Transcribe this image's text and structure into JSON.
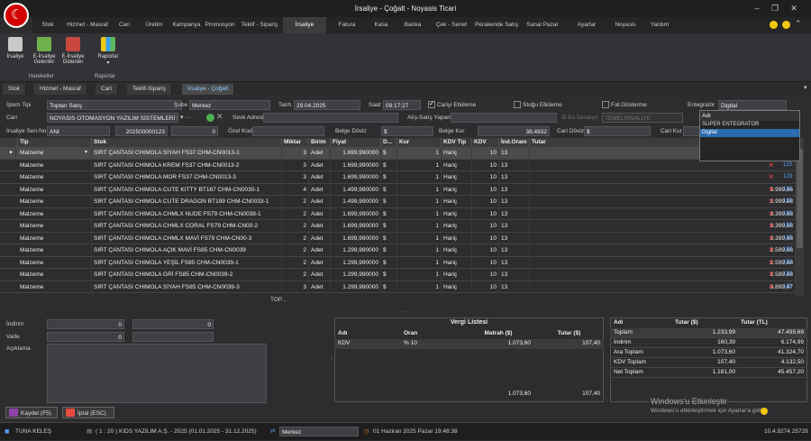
{
  "window": {
    "title": "İrsaliye - Çoğalt - Noyasis Ticari"
  },
  "menu": {
    "tabs": [
      "Stok",
      "Hizmet - Masraf",
      "Cari",
      "Üretim",
      "Kampanya",
      "Promosyon",
      "Teklif - Sipariş",
      "İrsaliye",
      "Fatura",
      "Kasa",
      "Banka",
      "Çek - Senet",
      "Perakende Satış",
      "Sanal Pazar",
      "Ayarlar",
      "Noyasis",
      "Yardım"
    ],
    "active": "İrsaliye"
  },
  "ribbon": {
    "buttons": [
      "İrsaliye",
      "E-İrsaliye Gelenler",
      "E-İrsaliye Gidenler",
      "Raporlar"
    ],
    "groups": [
      "Hareketler",
      "Raporlar"
    ]
  },
  "doctabs": {
    "tabs": [
      "Stok",
      "Hizmet - Masraf",
      "Cari",
      "Teklif-Sipariş",
      "İrsaliye - Çoğalt"
    ],
    "active": "İrsaliye - Çoğalt"
  },
  "form": {
    "islem_tipi_label": "İşlem Tipi",
    "islem_tipi": "Toptan Satış",
    "sube_label": "Şube",
    "sube": "Merkez",
    "tarih_label": "Tarih",
    "tarih": "29.04.2025",
    "saat_label": "Saat",
    "saat": "09:17:27",
    "cariyi_etkileme": "Cariyi Etkileme",
    "stogu_etkileme": "Stoğu Etkileme",
    "fat_gosterme": "Fat.Gösterme",
    "entegrator_label": "Entegratör",
    "entegrator": "Digital",
    "cari_label": "Cari",
    "cari": "NOYASIS OTOMASYON YAZILIM SİSTEMLERİ S...",
    "sevk_adresi_label": "Sevk Adresi",
    "alis_satis_yapan_label": "Alış-Satış Yapan",
    "e_irs_senaryo_label": "E-İrs.Senaryo",
    "e_irs_senaryo": "TEMELIRSALIYE",
    "seri_no_label": "İrsaliye Seri-No",
    "seri": "ANI",
    "no": "202500000123",
    "no2": "0",
    "ozel_kod_label": "Özel Kod",
    "belge_doviz_label": "Belge Döviz",
    "belge_doviz": "$",
    "belge_kur_label": "Belge Kur",
    "belge_kur": "38,4932",
    "cari_doviz_label": "Cari Döviz",
    "cari_doviz": "$",
    "cari_kur_label": "Cari Kur"
  },
  "dropdown": {
    "header": "Adı",
    "items": [
      "SUPER ENTEGRATOR",
      "Digital"
    ],
    "selected": "Digital"
  },
  "grid": {
    "columns": [
      "Tip",
      "Stok",
      "Miktar",
      "Birim",
      "Fiyat",
      "D...",
      "Kur",
      "KDV Tip",
      "KDV",
      "İnd.Oranı",
      "Tutar"
    ],
    "rows": [
      {
        "tip": "Malzeme",
        "stok": "SIRT ÇANTASI CHIMOLA SİYAH FS37 CHM-CN0013-1",
        "miktar": "3",
        "birim": "Adet",
        "fiyat": "1.699,990000",
        "d": "$",
        "kur": "1",
        "kdvtip": "Hariç",
        "kdv": "10",
        "ind": "13",
        "tutar": ""
      },
      {
        "tip": "Malzeme",
        "stok": "SIRT ÇANTASI CHIMOLA KREM FS37 CHM-CN0013-2",
        "miktar": "3",
        "birim": "Adet",
        "fiyat": "1.699,990000",
        "d": "$",
        "kur": "1",
        "kdvtip": "Hariç",
        "kdv": "10",
        "ind": "13",
        "tutar": ""
      },
      {
        "tip": "Malzeme",
        "stok": "SIRT ÇANTASI CHIMOLA MOR FS37 CHM-CN0013-3",
        "miktar": "3",
        "birim": "Adet",
        "fiyat": "1.699,990000",
        "d": "$",
        "kur": "1",
        "kdvtip": "Hariç",
        "kdv": "10",
        "ind": "13",
        "tutar": ""
      },
      {
        "tip": "Malzeme",
        "stok": "SIRT ÇANTASI CHIMOLA CUTE KITTY BT167 CHM-CN0030-1",
        "miktar": "4",
        "birim": "Adet",
        "fiyat": "1.499,990000",
        "d": "$",
        "kur": "1",
        "kdvtip": "Hariç",
        "kdv": "10",
        "ind": "13",
        "tutar": "5.999,96"
      },
      {
        "tip": "Malzeme",
        "stok": "SIRT ÇANTASI CHIMOLA CUTE DRAGON BT199 CHM-CN0033-1",
        "miktar": "2",
        "birim": "Adet",
        "fiyat": "1.499,990000",
        "d": "$",
        "kur": "1",
        "kdvtip": "Hariç",
        "kdv": "10",
        "ind": "13",
        "tutar": "2.999,98"
      },
      {
        "tip": "Malzeme",
        "stok": "SIRT ÇANTASI CHIMOLA CHMLX NUDE FS79 CHM-CN0038-1",
        "miktar": "2",
        "birim": "Adet",
        "fiyat": "1.699,990000",
        "d": "$",
        "kur": "1",
        "kdvtip": "Hariç",
        "kdv": "10",
        "ind": "13",
        "tutar": "3.399,98"
      },
      {
        "tip": "Malzeme",
        "stok": "SIRT ÇANTASI CHIMOLA CHMLX CORAL FS79 CHM-CN00-2",
        "miktar": "2",
        "birim": "Adet",
        "fiyat": "1.699,990000",
        "d": "$",
        "kur": "1",
        "kdvtip": "Hariç",
        "kdv": "10",
        "ind": "13",
        "tutar": "3.399,98"
      },
      {
        "tip": "Malzeme",
        "stok": "SIRT ÇANTASI CHIMOLA CHMLX MAVİ FS79 CHM-CN00-3",
        "miktar": "2",
        "birim": "Adet",
        "fiyat": "1.699,990000",
        "d": "$",
        "kur": "1",
        "kdvtip": "Hariç",
        "kdv": "10",
        "ind": "13",
        "tutar": "3.399,98"
      },
      {
        "tip": "Malzeme",
        "stok": "SIRT ÇANTASI CHIMOLA AÇIK MAVİ FS85 CHM-CN0039",
        "miktar": "2",
        "birim": "Adet",
        "fiyat": "1.299,990000",
        "d": "$",
        "kur": "1",
        "kdvtip": "Hariç",
        "kdv": "10",
        "ind": "13",
        "tutar": "2.599,98"
      },
      {
        "tip": "Malzeme",
        "stok": "SIRT ÇANTASI CHIMOLA YEŞİL FS85 CHM-CN0039-1",
        "miktar": "2",
        "birim": "Adet",
        "fiyat": "1.299,990000",
        "d": "$",
        "kur": "1",
        "kdvtip": "Hariç",
        "kdv": "10",
        "ind": "13",
        "tutar": "2.599,98"
      },
      {
        "tip": "Malzeme",
        "stok": "SIRT ÇANTASI CHIMOLA GRİ FS85 CHM-CN0039-2",
        "miktar": "2",
        "birim": "Adet",
        "fiyat": "1.299,990000",
        "d": "$",
        "kur": "1",
        "kdvtip": "Hariç",
        "kdv": "10",
        "ind": "13",
        "tutar": "2.599,98"
      },
      {
        "tip": "Malzeme",
        "stok": "SIRT ÇANTASI CHIMOLA SİYAH FS85 CHM-CN0039-3",
        "miktar": "3",
        "birim": "Adet",
        "fiyat": "1.299,990000",
        "d": "$",
        "kur": "1",
        "kdvtip": "Hariç",
        "kdv": "10",
        "ind": "13",
        "tutar": "3.899,97"
      }
    ],
    "footer": "TOP..."
  },
  "left_panel": {
    "indirim_label": "İndirim",
    "indirim1": "0",
    "indirim2": "0",
    "vade_label": "Vade",
    "vade1": "0",
    "aciklama_label": "Açıklama"
  },
  "vergi": {
    "title": "Vergi Listesi",
    "columns": [
      "Adı",
      "Oran",
      "Matrah ($)",
      "Tutar ($)"
    ],
    "rows": [
      {
        "adi": "KDV",
        "oran": "% 10",
        "matrah": "1.073,60",
        "tutar": "107,40"
      }
    ],
    "total_matrah": "1.073,60",
    "total_tutar": "107,40"
  },
  "toplam": {
    "columns": [
      "Adı",
      "Tutar ($)",
      "Tutar (TL)"
    ],
    "rows": [
      {
        "adi": "Toplam",
        "usd": "1.233,99",
        "tl": "47.499,69"
      },
      {
        "adi": "İndirim",
        "usd": "160,39",
        "tl": "6.174,99"
      },
      {
        "adi": "Ara Toplam",
        "usd": "1.073,60",
        "tl": "41.324,70"
      },
      {
        "adi": "KDV Toplam",
        "usd": "107,40",
        "tl": "4.132,50"
      },
      {
        "adi": "Net Toplam",
        "usd": "1.181,00",
        "tl": "45.457,20"
      }
    ]
  },
  "buttons": {
    "save": "Kaydet (F5)",
    "cancel": "İptal (ESC)"
  },
  "watermark": {
    "line1": "Windows'u Etkinleştir",
    "line2": "Windows'u etkinleştirmek için Ayarlar'a gidin."
  },
  "status": {
    "user": "TUNA KELEŞ",
    "company": "( 1 : 20 )  KIDS YAZILIM A.Ş. - 2025  (01.01.2025 - 31.12.2025)",
    "branch": "Merkez",
    "datetime": "01 Haziran 2025 Pazar 19:46:38",
    "version": "10.4.9274.25729"
  }
}
